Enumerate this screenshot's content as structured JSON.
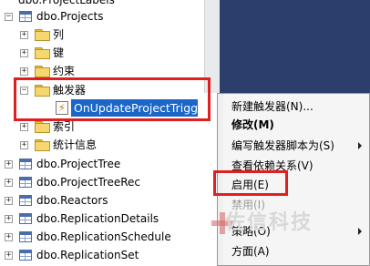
{
  "tree": {
    "partial_top": "dbo.ProjectLabels",
    "projects": "dbo.Projects",
    "col_folder": "列",
    "key_folder": "键",
    "constraint_folder": "约束",
    "trigger_folder": "触发器",
    "selected_trigger": "OnUpdateProjectTrigge",
    "index_folder": "索引",
    "stats_folder": "统计信息",
    "tables": [
      "dbo.ProjectTree",
      "dbo.ProjectTreeRec",
      "dbo.Reactors",
      "dbo.ReplicationDetails",
      "dbo.ReplicationSchedule",
      "dbo.ReplicationSet"
    ]
  },
  "context_menu": {
    "items": [
      {
        "label": "新建触发器(N)...",
        "state": "normal"
      },
      {
        "label": "修改(M)",
        "state": "bold"
      },
      {
        "label": "编写触发器脚本为(S)",
        "state": "normal",
        "submenu": true
      },
      {
        "label": "查看依赖关系(V)",
        "state": "normal"
      },
      {
        "label": "启用(E)",
        "state": "normal"
      },
      {
        "label": "禁用(I)",
        "state": "disabled"
      },
      {
        "label": "策略(O)",
        "state": "normal",
        "submenu": true
      },
      {
        "label": "方面(A)",
        "state": "normal"
      }
    ]
  },
  "watermark": "佐信科技",
  "colors": {
    "selection": "#1a66c9",
    "highlight_box": "#e02020"
  }
}
